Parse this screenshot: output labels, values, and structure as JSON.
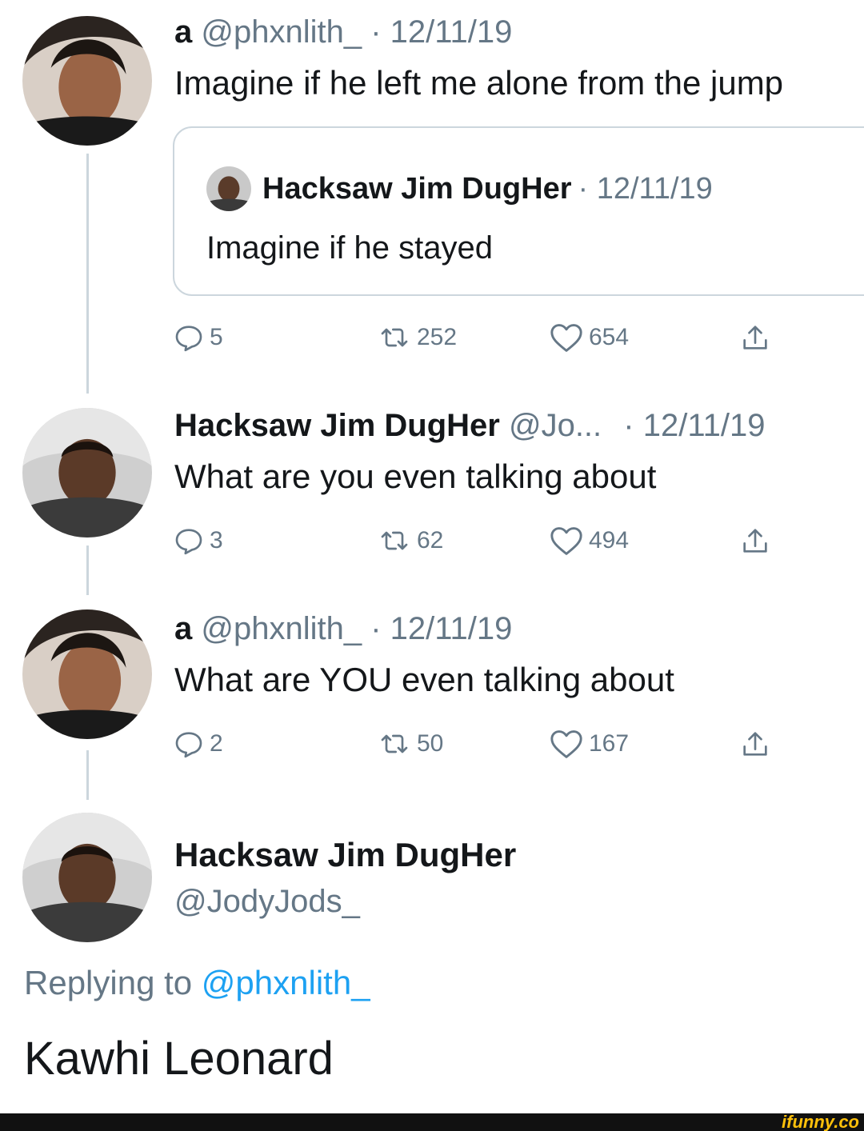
{
  "tweets": [
    {
      "name": "a",
      "handle": "@phxnlith_",
      "date": "· 12/11/19",
      "text": "Imagine if he left me alone from the jump",
      "quote": {
        "name": "Hacksaw Jim DugHer",
        "date": "· 12/11/19",
        "text": "Imagine if he stayed"
      },
      "stats": {
        "replies": "5",
        "retweets": "252",
        "likes": "654"
      }
    },
    {
      "name": "Hacksaw Jim DugHer",
      "handle": "@Jo...",
      "date": "· 12/11/19",
      "text": "What are you even talking about",
      "stats": {
        "replies": "3",
        "retweets": "62",
        "likes": "494"
      }
    },
    {
      "name": "a",
      "handle": "@phxnlith_",
      "date": "· 12/11/19",
      "text": "What are YOU even talking about",
      "stats": {
        "replies": "2",
        "retweets": "50",
        "likes": "167"
      }
    }
  ],
  "main_tweet": {
    "name": "Hacksaw Jim DugHer",
    "handle": "@JodyJods_",
    "replying_prefix": "Replying to",
    "replying_handle": "@phxnlith_",
    "text": "Kawhi Leonard"
  },
  "watermark": "ifunny.co",
  "icons": {
    "reply": "reply-icon",
    "retweet": "retweet-icon",
    "like": "heart-icon",
    "share": "share-icon"
  },
  "colors": {
    "text": "#14171a",
    "muted": "#657786",
    "link": "#1da1f2",
    "border": "#ccd6dd",
    "watermark": "#ffc00a"
  }
}
